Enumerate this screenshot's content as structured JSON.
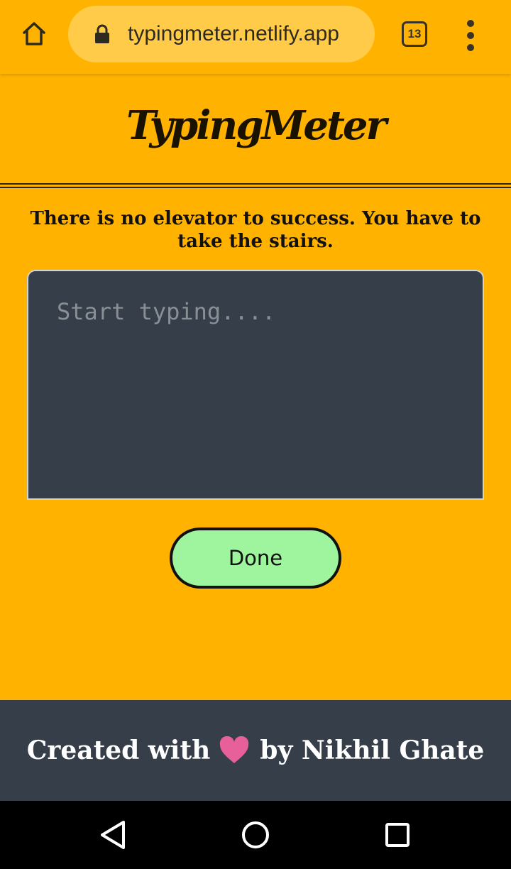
{
  "browser": {
    "url": "typingmeter.netlify.app",
    "tab_count": "13",
    "icons": [
      "home-icon",
      "lock-icon",
      "tabs-icon",
      "more-vert-icon"
    ]
  },
  "header": {
    "logo_text": "TypingMeter"
  },
  "main": {
    "quote": "There is no elevator to success. You have to take the stairs.",
    "typing_placeholder": "Start typing....",
    "typing_value": "",
    "done_label": "Done"
  },
  "footer": {
    "prefix": "Created with",
    "suffix": "by Nikhil Ghate"
  },
  "colors": {
    "page_bg": "#FFB300",
    "url_pill_bg": "#FFCB48",
    "textarea_bg": "#363F49",
    "done_button_bg": "#9EF59D",
    "footer_bg": "#363F49",
    "heart": "#E8609A"
  },
  "system_nav": {
    "icons": [
      "back-icon",
      "home-circle-icon",
      "recents-icon"
    ]
  }
}
